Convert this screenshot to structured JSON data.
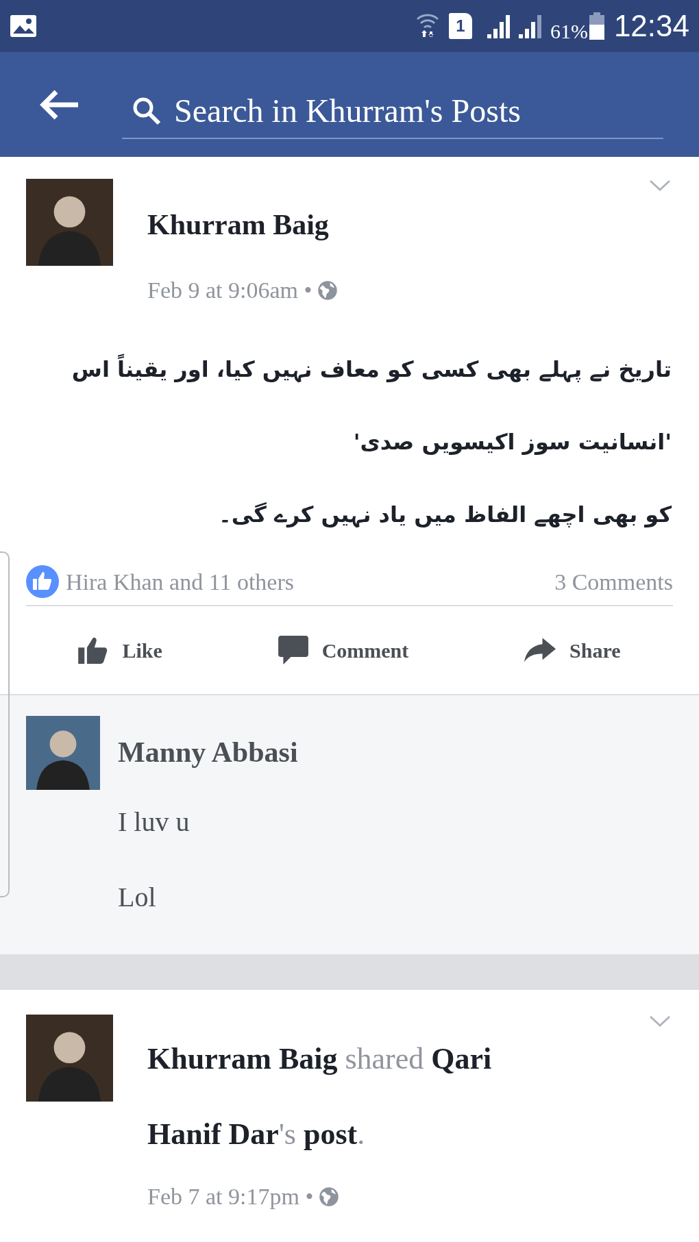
{
  "status_bar": {
    "battery": "61%",
    "time": "12:34",
    "sim": "1"
  },
  "header": {
    "search": {
      "placeholder": "Search in Khurram's Posts"
    }
  },
  "posts": [
    {
      "author": "**Khurram Baig**",
      "date": "Feb 9 at 9:06am •",
      "body": [
        "تاریخ نے پہلے بھی  کسی کو معاف نہیں کیا، اور یقیناً اس",
        "'انسانیت سوز اکیسویں صدی'",
        "کو بھی اچھے الفاظ میں یاد نہیں کرے گی۔"
      ],
      "likes": "Hira Khan and 11 others",
      "comments_count": "3 Comments",
      "actions": [
        {
          "kind": "like",
          "label": "Like"
        },
        {
          "kind": "comment",
          "label": "Comment"
        },
        {
          "kind": "share",
          "label": "Share"
        }
      ],
      "comments": [
        {
          "author": "Manny Abbasi",
          "lines": [
            "I luv u",
            "Lol"
          ]
        }
      ]
    },
    {
      "author": "**Khurram Baig** shared **Qari Hanif Dar**'s **post**.",
      "date": "Feb 7 at 9:17pm •"
    }
  ]
}
